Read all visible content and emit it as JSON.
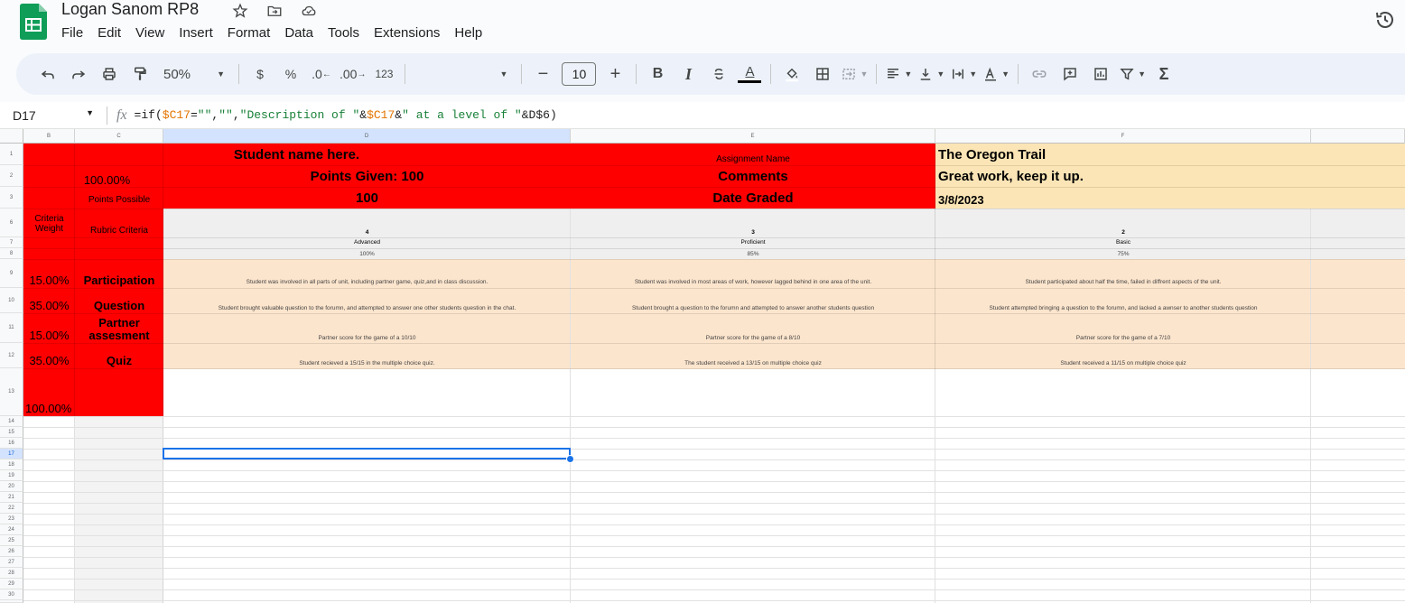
{
  "app": {
    "doc_title": "Logan Sanom RP8",
    "menu": [
      "File",
      "Edit",
      "View",
      "Insert",
      "Format",
      "Data",
      "Tools",
      "Extensions",
      "Help"
    ]
  },
  "toolbar": {
    "zoom": "50%",
    "currency": "$",
    "percent": "%",
    "dec_decrease": ".0",
    "dec_increase": ".00",
    "number_format": "123",
    "font_size": "10",
    "bold": "B",
    "italic": "I",
    "text_color_glyph": "A"
  },
  "formula_bar": {
    "cell_ref": "D17",
    "fx": "fx",
    "parts": [
      "=if(",
      "$C17",
      "=",
      "\"\"",
      ",",
      "\"\"",
      ",",
      "\"Description of \"",
      "&",
      "$C17",
      "&",
      "\" at a level of \"",
      "&D$6)"
    ]
  },
  "columns": [
    "B",
    "C",
    "D",
    "E",
    "F"
  ],
  "rows": [
    "1",
    "2",
    "3",
    "6",
    "7",
    "8",
    "9",
    "10",
    "11",
    "12",
    "13",
    "14",
    "15",
    "16",
    "17",
    "18",
    "19",
    "20",
    "21",
    "22",
    "23",
    "24",
    "25",
    "26",
    "27",
    "28",
    "29",
    "30"
  ],
  "sheet": {
    "student_name": "Student name here.",
    "points_given": "Points Given: 100",
    "points_value": "100",
    "percent_total": "100.00%",
    "points_possible": "Points Possible",
    "assignment_name_label": "Assignment Name",
    "comments_label": "Comments",
    "date_graded_label": "Date Graded",
    "assignment_name": "The Oregon Trail",
    "comments": "Great work, keep it up.",
    "date_graded": "3/8/2023",
    "criteria_weight": "Criteria Weight",
    "rubric_criteria": "Rubric Criteria",
    "levels": [
      {
        "score": "4",
        "name": "Advanced",
        "pct": "100%"
      },
      {
        "score": "3",
        "name": "Proficient",
        "pct": "85%"
      },
      {
        "score": "2",
        "name": "Basic",
        "pct": "75%"
      }
    ],
    "criteria": [
      {
        "weight": "15.00%",
        "name": "Participation",
        "d": "Student was involved in all parts of unit, including partner game, quiz,and in class discussion.",
        "e": "Student was involved in most areas of work, however lagged behind in one area of the unit.",
        "f": "Student participated about half the time,  failed in diffrent aspects of the unit."
      },
      {
        "weight": "35.00%",
        "name": "Question",
        "d": "Student brought valuable question to the forumn, and attempted to answer one other students question in the chat.",
        "e": "Student brought a question to the forumn and attempted to answer another students question",
        "f": "Student attempted bringing a question to the forumn, and  lacked a awnser to another students question"
      },
      {
        "weight": "15.00%",
        "name": "Partner assesment",
        "d": "Partner score for the game of a 10/10",
        "e": "Partner score for the game of a 8/10",
        "f": "Partner score for the game of a 7/10"
      },
      {
        "weight": "35.00%",
        "name": "Quiz",
        "d": "Student recieved a 15/15 in the multiple choice quiz.",
        "e": "The student received a 13/15 on multiple choice quiz",
        "f": "Student received a  11/15 on multiple choice quiz"
      }
    ],
    "weight_total": "100.00%"
  }
}
